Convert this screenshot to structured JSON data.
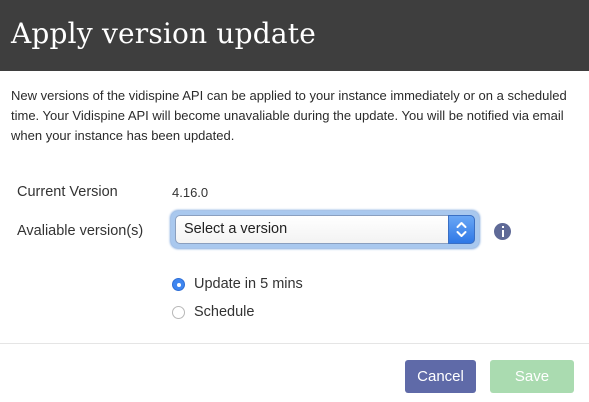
{
  "dialog": {
    "title": "Apply version update",
    "description": "New versions of the vidispine API can be applied to your instance immediately or on a scheduled time. Your Vidispine API will become unavaliable during the update. You will be notified via email when your instance has been updated.",
    "current_version": {
      "label": "Current Version",
      "value": "4.16.0"
    },
    "available_versions": {
      "label": "Avaliable version(s)",
      "selected": "Select a version"
    },
    "update_options": [
      {
        "label": "Update in 5 mins",
        "checked": true
      },
      {
        "label": "Schedule",
        "checked": false
      }
    ],
    "buttons": {
      "cancel": "Cancel",
      "save": "Save"
    }
  },
  "colors": {
    "header_bg": "#3e3e3e",
    "cancel_bg": "#5f6aa8",
    "save_bg_disabled": "#aadbb0",
    "radio_accent": "#3f86f0",
    "info_icon": "#5f6a97"
  },
  "icons": {
    "select_arrows": "chevron-up-down-icon",
    "info": "info-icon"
  }
}
